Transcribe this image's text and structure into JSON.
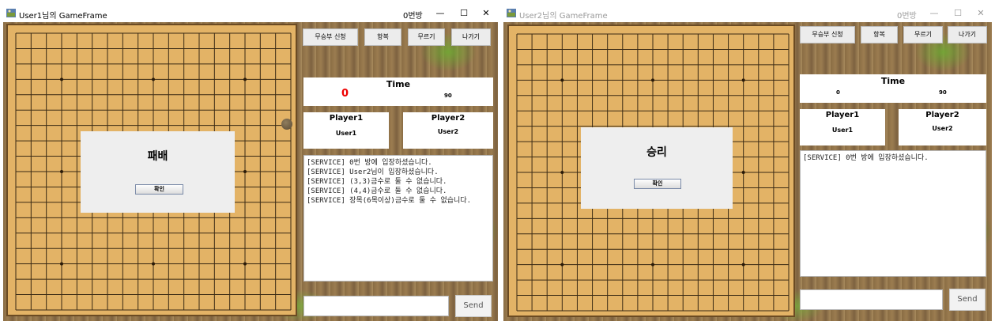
{
  "windows": [
    {
      "title": "User1님의 GameFrame",
      "room": "0번방",
      "controls": {
        "minimize": "—",
        "maximize": "☐",
        "close": "✕"
      },
      "buttons": {
        "draw": "무승부 신청",
        "surrender": "항복",
        "undo": "무르기",
        "exit": "나가기"
      },
      "time": {
        "title": "Time",
        "left": "0",
        "right": "90",
        "left_color": "#ee0000"
      },
      "player1": {
        "label": "Player1",
        "name": "User1"
      },
      "player2": {
        "label": "Player2",
        "name": "User2"
      },
      "log": [
        "[SERVICE] 0번 방에 입장하셨습니다.",
        "[SERVICE] User2님이 입장하셨습니다.",
        "[SERVICE] (3,3)금수로 둘 수 없습니다.",
        "[SERVICE] (4,4)금수로 둘 수 없습니다.",
        "[SERVICE] 장목(6목이상)금수로 둘 수 없습니다."
      ],
      "chat_input": "",
      "send_label": "Send",
      "dialog": {
        "message": "패배",
        "ok": "확인"
      }
    },
    {
      "title": "User2님의 GameFrame",
      "room": "0번방",
      "controls": {
        "minimize": "—",
        "maximize": "☐",
        "close": "✕"
      },
      "buttons": {
        "draw": "무승부 신청",
        "surrender": "항복",
        "undo": "무르기",
        "exit": "나가기"
      },
      "time": {
        "title": "Time",
        "left": "0",
        "right": "90",
        "left_color": "#000000"
      },
      "player1": {
        "label": "Player1",
        "name": "User1"
      },
      "player2": {
        "label": "Player2",
        "name": "User2"
      },
      "log": [
        "[SERVICE] 0번 방에 입장하셨습니다."
      ],
      "chat_input": "",
      "send_label": "Send",
      "dialog": {
        "message": "승리",
        "ok": "확인"
      }
    }
  ]
}
